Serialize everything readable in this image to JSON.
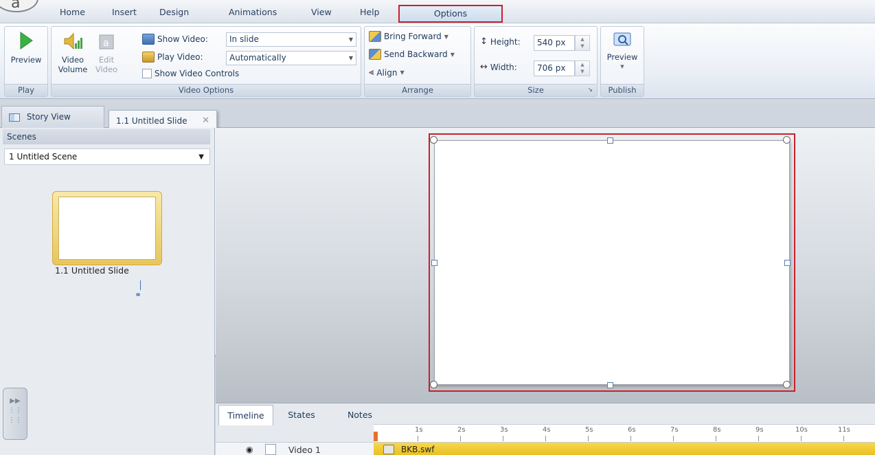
{
  "tabs": {
    "home": "Home",
    "insert": "Insert",
    "design": "Design",
    "animations": "Animations",
    "view": "View",
    "help": "Help",
    "options": "Options"
  },
  "ribbon": {
    "play_group": {
      "preview_label": "Preview",
      "group_label": "Play"
    },
    "video_options": {
      "video_volume": "Video Volume",
      "edit_video": "Edit Video",
      "show_video_label": "Show Video:",
      "show_video_value": "In slide",
      "play_video_label": "Play Video:",
      "play_video_value": "Automatically",
      "show_controls_label": "Show Video Controls",
      "show_controls_checked": false,
      "group_label": "Video Options"
    },
    "arrange": {
      "bring_forward": "Bring Forward",
      "send_backward": "Send Backward",
      "align": "Align",
      "group_label": "Arrange"
    },
    "size": {
      "height_label": "Height:",
      "height_value": "540 px",
      "width_label": "Width:",
      "width_value": "706 px",
      "group_label": "Size"
    },
    "publish": {
      "preview_label": "Preview",
      "group_label": "Publish"
    }
  },
  "doc_tabs": {
    "story_view": "Story View",
    "slide_tab": "1.1 Untitled Slide"
  },
  "scenes_panel": {
    "header": "Scenes",
    "selected_scene": "1 Untitled Scene",
    "slide_thumb_label": "1.1 Untitled Slide"
  },
  "timeline": {
    "tabs": [
      "Timeline",
      "States",
      "Notes"
    ],
    "ruler_labels": [
      "1s",
      "2s",
      "3s",
      "4s",
      "5s",
      "6s",
      "7s",
      "8s",
      "9s",
      "10s",
      "11s"
    ],
    "track_name": "Video 1",
    "track_clip": "BKB.swf"
  },
  "colors": {
    "highlight_red": "#c8202a",
    "track_yellow": "#f0ca30",
    "thumb_gold": "#e8c65c",
    "play_green": "#3bb143"
  },
  "icons": [
    "play-icon",
    "speaker-icon",
    "edit-video-icon",
    "show-video-icon",
    "play-video-icon",
    "bring-forward-icon",
    "send-backward-icon",
    "align-icon",
    "height-icon",
    "width-icon",
    "publish-preview-icon",
    "story-view-icon",
    "close-icon",
    "link-icon",
    "expand-handle-icon",
    "eye-icon"
  ]
}
